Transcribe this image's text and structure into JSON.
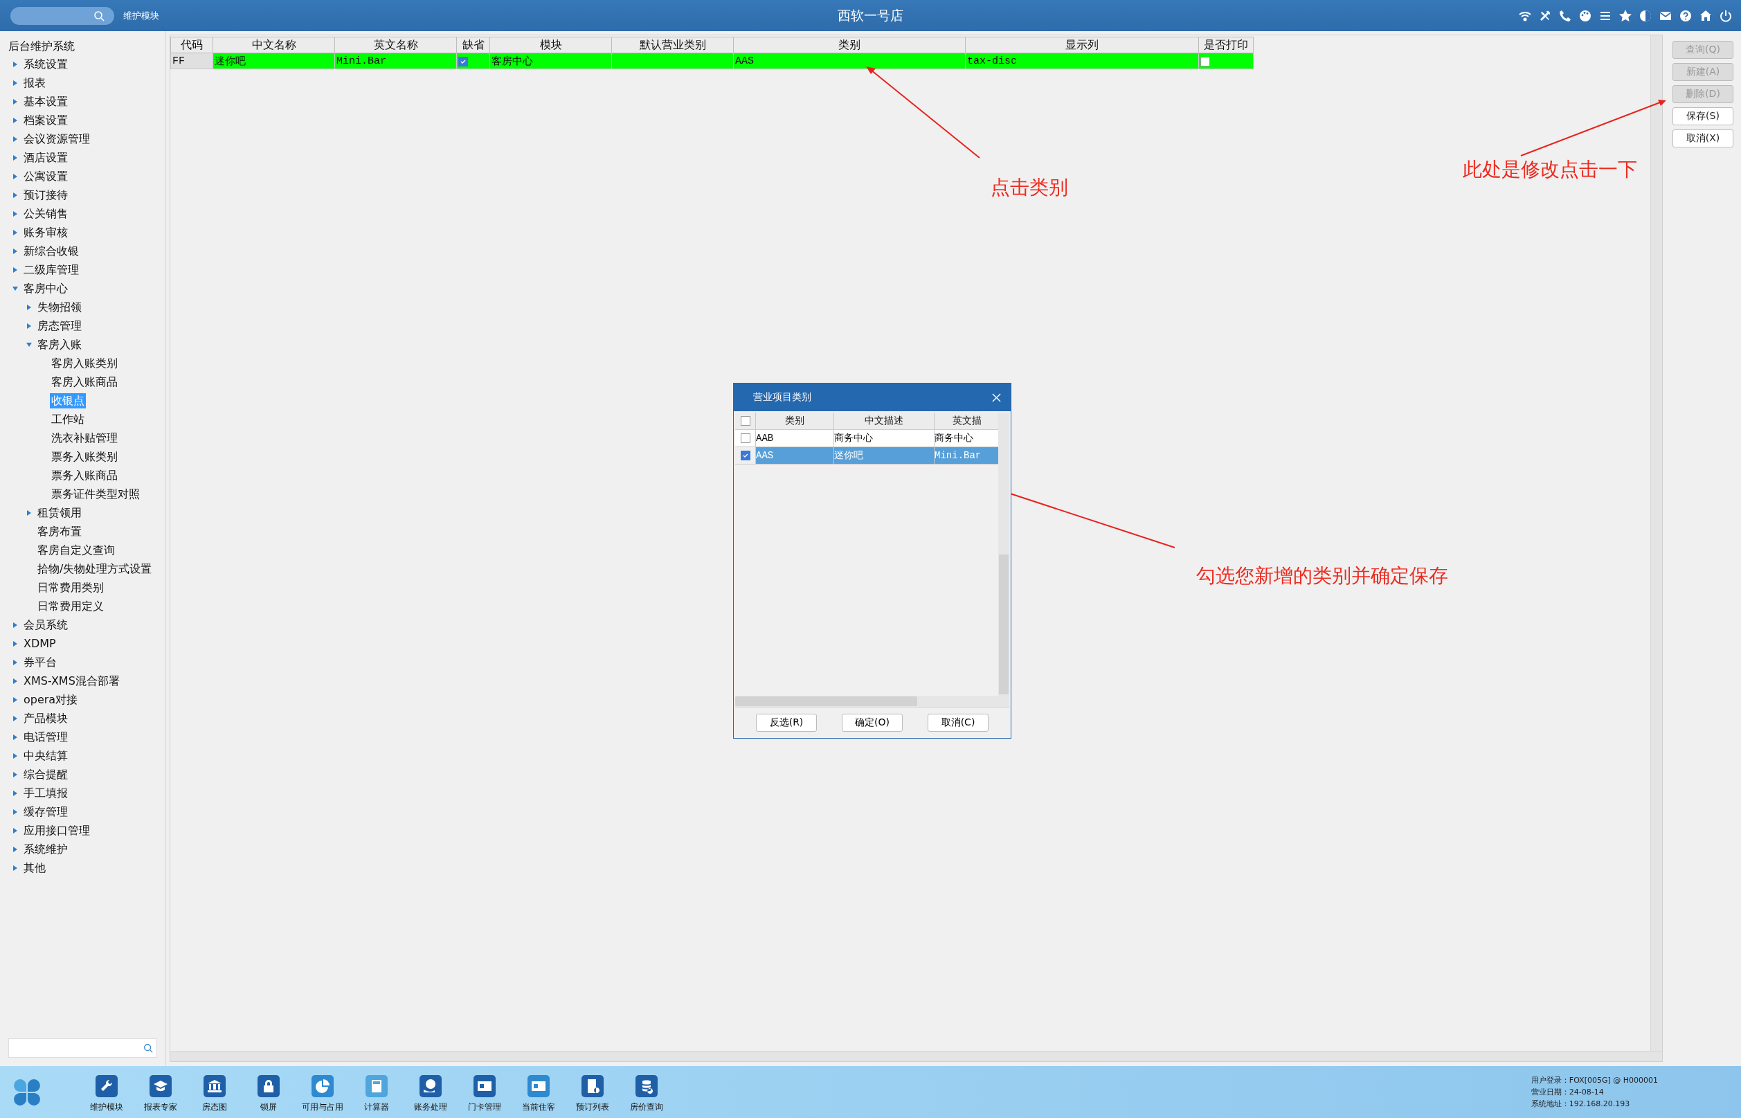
{
  "top_bar": {
    "module_label": "维护模块",
    "title": "西软一号店"
  },
  "sidebar": {
    "title": "后台维护系统",
    "items": [
      {
        "label": "系统设置",
        "expanded": false,
        "selected": false
      },
      {
        "label": "报表",
        "expanded": false,
        "selected": false
      },
      {
        "label": "基本设置",
        "expanded": false,
        "selected": false
      },
      {
        "label": "档案设置",
        "expanded": false,
        "selected": false
      },
      {
        "label": "会议资源管理",
        "expanded": false,
        "selected": false
      },
      {
        "label": "酒店设置",
        "expanded": false,
        "selected": false
      },
      {
        "label": "公寓设置",
        "expanded": false,
        "selected": false
      },
      {
        "label": "预订接待",
        "expanded": false,
        "selected": false
      },
      {
        "label": "公关销售",
        "expanded": false,
        "selected": false
      },
      {
        "label": "账务审核",
        "expanded": false,
        "selected": false
      },
      {
        "label": "新综合收银",
        "expanded": false,
        "selected": false
      },
      {
        "label": "二级库管理",
        "expanded": false,
        "selected": false
      },
      {
        "label": "客房中心",
        "expanded": true,
        "selected": false,
        "children": [
          {
            "label": "失物招领",
            "expanded": false,
            "selected": false
          },
          {
            "label": "房态管理",
            "expanded": false,
            "selected": false
          },
          {
            "label": "客房入账",
            "expanded": true,
            "selected": false,
            "children": [
              {
                "label": "客房入账类别",
                "selected": false
              },
              {
                "label": "客房入账商品",
                "selected": false
              },
              {
                "label": "收银点",
                "selected": true
              },
              {
                "label": "工作站",
                "selected": false
              },
              {
                "label": "洗衣补贴管理",
                "selected": false
              },
              {
                "label": "票务入账类别",
                "selected": false
              },
              {
                "label": "票务入账商品",
                "selected": false
              },
              {
                "label": "票务证件类型对照",
                "selected": false
              }
            ]
          },
          {
            "label": "租赁领用",
            "expanded": false,
            "selected": false
          },
          {
            "label": "客房布置",
            "selected": false
          },
          {
            "label": "客房自定义查询",
            "selected": false
          },
          {
            "label": "拾物/失物处理方式设置",
            "selected": false
          },
          {
            "label": "日常费用类别",
            "selected": false
          },
          {
            "label": "日常费用定义",
            "selected": false
          }
        ]
      },
      {
        "label": "会员系统",
        "expanded": false,
        "selected": false
      },
      {
        "label": "XDMP",
        "expanded": false,
        "selected": false
      },
      {
        "label": "券平台",
        "expanded": false,
        "selected": false
      },
      {
        "label": "XMS-XMS混合部署",
        "expanded": false,
        "selected": false
      },
      {
        "label": "opera对接",
        "expanded": false,
        "selected": false
      },
      {
        "label": "产品模块",
        "expanded": false,
        "selected": false
      },
      {
        "label": "电话管理",
        "expanded": false,
        "selected": false
      },
      {
        "label": "中央结算",
        "expanded": false,
        "selected": false
      },
      {
        "label": "综合提醒",
        "expanded": false,
        "selected": false
      },
      {
        "label": "手工填报",
        "expanded": false,
        "selected": false
      },
      {
        "label": "缓存管理",
        "expanded": false,
        "selected": false
      },
      {
        "label": "应用接口管理",
        "expanded": false,
        "selected": false
      },
      {
        "label": "系统维护",
        "expanded": false,
        "selected": false
      },
      {
        "label": "其他",
        "expanded": false,
        "selected": false
      }
    ]
  },
  "table": {
    "columns": [
      "代码",
      "中文名称",
      "英文名称",
      "缺省",
      "模块",
      "默认营业类别",
      "类别",
      "显示列",
      "是否打印"
    ],
    "rows": [
      {
        "selected": true,
        "code": "FF",
        "name_cn": "迷你吧",
        "name_en": "Mini.Bar",
        "default_checked": true,
        "module": "客房中心",
        "category": "AAS",
        "display_column": "tax-disc",
        "print_checked": false
      }
    ]
  },
  "actions": [
    {
      "label": "查询(Q)",
      "disabled": true
    },
    {
      "label": "新建(A)",
      "disabled": true
    },
    {
      "label": "删除(D)",
      "disabled": true
    },
    {
      "label": "保存(S)",
      "disabled": false
    },
    {
      "label": "取消(X)",
      "disabled": false
    }
  ],
  "dialog": {
    "title": "营业项目类别",
    "all_checked": false,
    "columns": [
      "类别",
      "中文描述",
      "英文描"
    ],
    "rows": [
      {
        "checked": false,
        "selected": false,
        "cells": [
          "AAB",
          "商务中心",
          "商务中心"
        ]
      },
      {
        "checked": true,
        "selected": true,
        "cells": [
          "AAS",
          "迷你吧",
          "Mini.Bar"
        ]
      }
    ],
    "buttons": [
      "反选(R)",
      "确定(O)",
      "取消(C)"
    ]
  },
  "annotations": [
    {
      "text": "点击类别"
    },
    {
      "text": "此处是修改点击一下"
    },
    {
      "text": "勾选您新增的类别并确定保存"
    }
  ],
  "taskbar": {
    "items": [
      {
        "label": "维护模块"
      },
      {
        "label": "报表专家"
      },
      {
        "label": "房态图"
      },
      {
        "label": "锁屏"
      },
      {
        "label": "可用与占用"
      },
      {
        "label": "计算器"
      },
      {
        "label": "账务处理"
      },
      {
        "label": "门卡管理"
      },
      {
        "label": "当前住客"
      },
      {
        "label": "预订列表"
      },
      {
        "label": "房价查询"
      }
    ],
    "status": [
      "用户登录：FOX[005G] @ H000001",
      "营业日期：24-08-14",
      "系统地址：192.168.20.193"
    ]
  }
}
